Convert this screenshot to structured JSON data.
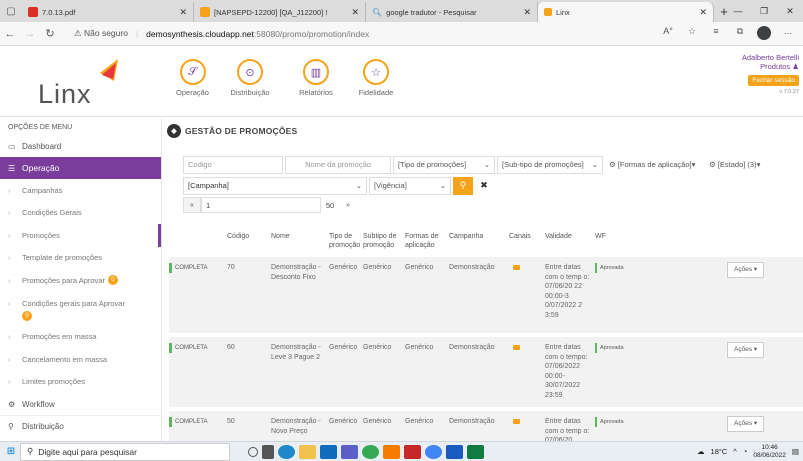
{
  "browser": {
    "tabs": [
      {
        "title": "7.0.13.pdf",
        "color": "#d93025",
        "active": false
      },
      {
        "title": "[NAPSEPD-12200] [QA_J12200] !",
        "color": "#f5a31a",
        "active": false
      },
      {
        "title": "google tradutor - Pesquisar",
        "color": "#0078d4",
        "active": false
      },
      {
        "title": "Linx",
        "color": "#f5a31a",
        "active": true
      }
    ],
    "new_tab": "+",
    "security": "Não seguro",
    "url_host": "demosynthesis.cloudapp.net",
    "url_path": ":58080/promo/promotion/index"
  },
  "header": {
    "logo_text": "Linx",
    "modules": [
      "Operação",
      "Distribuição",
      "Relatórios",
      "Fidelidade"
    ],
    "user_name": "Adalberto Bertelli",
    "user_products": "Produtos",
    "logout_label": "Fechar sessão",
    "version": "v 7.0.27"
  },
  "sidebar": {
    "title": "OPÇÕES DE MENU",
    "dashboard": "Dashboard",
    "section": "Operação",
    "items": [
      {
        "label": "Campanhas",
        "badge": ""
      },
      {
        "label": "Condições Gerais",
        "badge": ""
      },
      {
        "label": "Promoções",
        "badge": ""
      },
      {
        "label": "Template de promoções",
        "badge": ""
      },
      {
        "label": "Promoções para Aprovar",
        "badge": "0"
      },
      {
        "label": "Condições gerais para Aprovar",
        "badge": "0"
      },
      {
        "label": "Promoções em massa",
        "badge": ""
      },
      {
        "label": "Cancelamento em massa",
        "badge": ""
      },
      {
        "label": "Limites promoções",
        "badge": ""
      }
    ],
    "workflow": "Workflow",
    "distribuicao": "Distribuição"
  },
  "main": {
    "title": "GESTÃO DE PROMOÇÕES",
    "filters": {
      "codigo_placeholder": "Codigo",
      "nome_placeholder": "Nome da promoção",
      "tipo": "[Tipo de promoções]",
      "subtipo": "[Sub-tipo de promoções]",
      "formas": "[Formas de aplicação]",
      "estado": "[Estado] (3)",
      "campanha": "[Campanha]",
      "vigencia": "[Vigência]"
    },
    "pager": {
      "first": "«",
      "page": "1",
      "size": "50",
      "next": "»"
    },
    "columns": [
      "Código",
      "Nome",
      "Tipo de promoção",
      "Subtipo de promoção",
      "Formas de aplicação",
      "Campanha",
      "Canais",
      "Validade",
      "WF"
    ],
    "rows": [
      {
        "status": "COMPLETA",
        "code": "70",
        "name": "Demonstração - Desconto Fixo",
        "tipo": "Genérico",
        "subtipo": "Genérico",
        "formas": "Genérico",
        "campanha": "Demonstração",
        "validade": "Entre datas com o temp o: 07/06/20 22 00:00-3 0/07/2022 2 3:59",
        "wf": "Aprovada",
        "action": "Ações"
      },
      {
        "status": "COMPLETA",
        "code": "60",
        "name": "Demonstração - Leve 3 Pague 2",
        "tipo": "Genérico",
        "subtipo": "Genérico",
        "formas": "Genérico",
        "campanha": "Demonstração",
        "validade": "Entre datas com o tempo: 07/06/2022 00:00- 30/07/2022 23:59",
        "wf": "Aprovada",
        "action": "Ações"
      },
      {
        "status": "COMPLETA",
        "code": "50",
        "name": "Demonstração - Novo Preço",
        "tipo": "Genérico",
        "subtipo": "Genérico",
        "formas": "Genérico",
        "campanha": "Demonstração",
        "validade": "Entre datas com o temp o: 07/06/20",
        "wf": "Aprovada",
        "action": "Ações"
      }
    ]
  },
  "taskbar": {
    "search_placeholder": "Digite aqui para pesquisar",
    "temperature": "18°C",
    "time": "10:46",
    "date": "08/06/2022"
  }
}
